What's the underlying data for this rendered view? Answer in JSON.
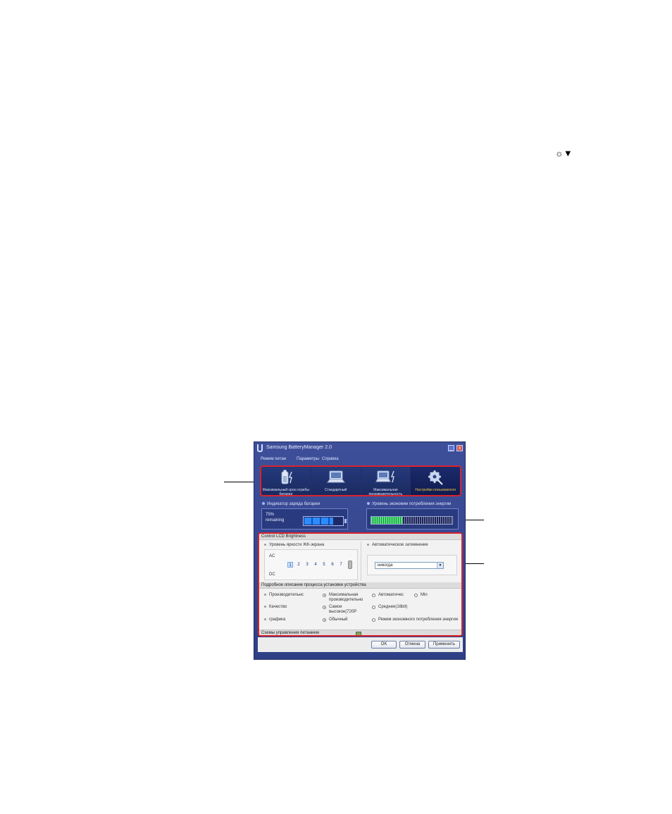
{
  "page": {
    "corner_icon": "☼▼"
  },
  "window": {
    "title": "Samsung BatteryManager 2.0",
    "controls": {
      "minimize": "_",
      "close": "x"
    },
    "menu": [
      "Режим питан",
      "Параметры",
      "Справка"
    ]
  },
  "modes": [
    {
      "label": "Максимальный срок службы батареи",
      "icon": "battery-icon",
      "active": false
    },
    {
      "label": "Стандартный",
      "icon": "laptop-icon",
      "active": false
    },
    {
      "label": "Максимальная производительность",
      "icon": "laptop-power-icon",
      "active": false
    },
    {
      "label": "Настройки пользователя",
      "icon": "gear-icon",
      "active": true
    }
  ],
  "battery": {
    "label": "Индикатор заряда батареи",
    "percent_text": "75%",
    "remaining_text": "remaining",
    "level_percent": 75
  },
  "energy": {
    "label": "Уровень экономии потребления энергии",
    "level_fraction": 0.38
  },
  "brightness": {
    "header": "Control LCD Brightness",
    "label": "Уровень яркости ЖК-экрана",
    "ac": "AC",
    "dc": "DC",
    "levels": [
      "1",
      "2",
      "3",
      "4",
      "5",
      "6",
      "7"
    ],
    "selected_level": "1"
  },
  "auto_dim": {
    "label": "Автоматическое затемнение",
    "value": "никогда"
  },
  "device": {
    "header": "Подробное описание процесса установки устройства",
    "rows": [
      {
        "label": "Производительнс",
        "option_on": "Максимальная производительно",
        "option_a": "Автоматичес",
        "option_b": "Min"
      },
      {
        "label": "Качество",
        "option_on": "Самое высокое(720P",
        "option_a": "Среднее(16bit)"
      },
      {
        "label": "графика",
        "option_on": "Обычный",
        "option_a": "Режим экономного потребления энергии"
      }
    ]
  },
  "power_schemes": {
    "label": "Схемы управления питанием"
  },
  "buttons": {
    "ok": "OK",
    "cancel": "Отмена",
    "apply": "Применить"
  }
}
